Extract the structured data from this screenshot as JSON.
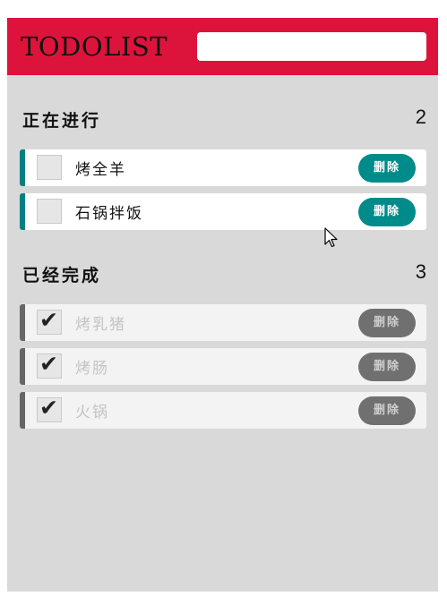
{
  "header": {
    "title": "TODOLIST",
    "input_value": "",
    "input_placeholder": ""
  },
  "colors": {
    "header_bg": "#dc143c",
    "accent": "#008b8b",
    "done_accent": "#707070",
    "panel_bg": "#d9d9d9"
  },
  "in_progress": {
    "title": "正在进行",
    "count": "2",
    "items": [
      {
        "text": "烤全羊",
        "checked": false,
        "delete_label": "删除"
      },
      {
        "text": "石锅拌饭",
        "checked": false,
        "delete_label": "删除"
      }
    ]
  },
  "completed": {
    "title": "已经完成",
    "count": "3",
    "items": [
      {
        "text": "烤乳猪",
        "checked": true,
        "check_mark": "✔",
        "delete_label": "删除"
      },
      {
        "text": "烤肠",
        "checked": true,
        "check_mark": "✔",
        "delete_label": "删除"
      },
      {
        "text": "火锅",
        "checked": true,
        "check_mark": "✔",
        "delete_label": "删除"
      }
    ]
  }
}
